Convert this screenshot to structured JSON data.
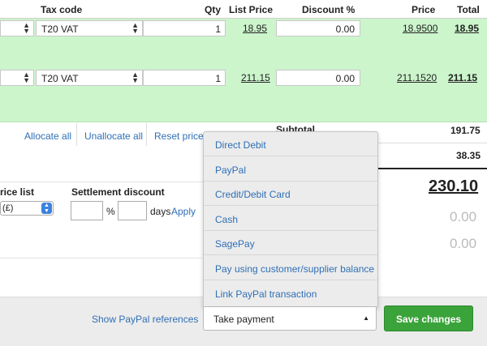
{
  "columns": {
    "tax_code": "Tax code",
    "qty": "Qty",
    "list_price": "List Price",
    "discount": "Discount %",
    "price": "Price",
    "total": "Total"
  },
  "lines": [
    {
      "tax_code": "T20 VAT",
      "qty": "1",
      "list_price": "18.95",
      "discount": "0.00",
      "price": "18.9500",
      "total": "18.95"
    },
    {
      "tax_code": "T20 VAT",
      "qty": "1",
      "list_price": "211.15",
      "discount": "0.00",
      "price": "211.1520",
      "total": "211.15"
    }
  ],
  "actions": {
    "allocate_all": "Allocate all",
    "unallocate_all": "Unallocate all",
    "reset_prices": "Reset prices"
  },
  "totals": {
    "subtotal_label": "Subtotal",
    "subtotal": "191.75",
    "vat": "38.35",
    "grand_total": "230.10",
    "paid": "0.00",
    "outstanding": "0.00"
  },
  "settlement": {
    "price_list_label": "rice list",
    "price_list_value": "(£)",
    "discount_label": "Settlement discount",
    "percent_symbol": "%",
    "days_label": "days",
    "apply_label": "Apply"
  },
  "footer": {
    "paypal_refs": "Show PayPal references",
    "take_payment": "Take payment",
    "save_changes": "Save changes"
  },
  "payment_menu": [
    "Direct Debit",
    "PayPal",
    "Credit/Debit Card",
    "Cash",
    "SagePay",
    "Pay using customer/supplier balance",
    "Link PayPal transaction"
  ],
  "colors": {
    "row_bg": "#ccf5cc",
    "link": "#2f6fb5",
    "save_bg": "#3aa33a"
  }
}
